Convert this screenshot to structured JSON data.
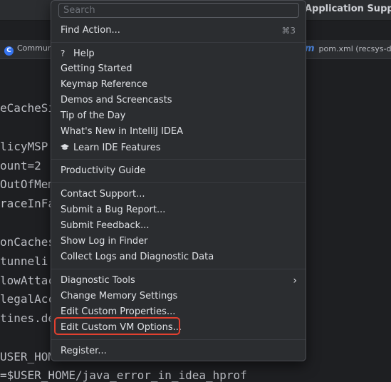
{
  "window": {
    "title_fragment": "Application Support"
  },
  "tabs": {
    "left": {
      "icon": "class-c-icon",
      "label": "Commun"
    },
    "right": {
      "icon": "maven-m-icon",
      "label": "pom.xml (recsys-d"
    }
  },
  "editor_lines": [
    "eCacheSi",
    "licyMSP",
    "ount=2",
    "OutOfMem",
    "raceInFa",
    "onCaches",
    "tunneli",
    "lowAttac",
    "legalAcc",
    "tines.de",
    "USER_HOM",
    "=$USER_HOME/java_error_in_idea_hprof"
  ],
  "menu": {
    "search_placeholder": "Search",
    "items": [
      {
        "label": "Find Action...",
        "shortcut": "⌘3"
      },
      {
        "label": "Help",
        "icon": "question-icon"
      },
      {
        "label": "Getting Started"
      },
      {
        "label": "Keymap Reference"
      },
      {
        "label": "Demos and Screencasts"
      },
      {
        "label": "Tip of the Day"
      },
      {
        "label": "What's New in IntelliJ IDEA"
      },
      {
        "label": "Learn IDE Features",
        "icon": "graduation-cap-icon"
      },
      {
        "label": "Productivity Guide"
      },
      {
        "label": "Contact Support..."
      },
      {
        "label": "Submit a Bug Report..."
      },
      {
        "label": "Submit Feedback..."
      },
      {
        "label": "Show Log in Finder"
      },
      {
        "label": "Collect Logs and Diagnostic Data"
      },
      {
        "label": "Diagnostic Tools",
        "submenu": true
      },
      {
        "label": "Change Memory Settings"
      },
      {
        "label": "Edit Custom Properties..."
      },
      {
        "label": "Edit Custom VM Options...",
        "highlighted": true
      },
      {
        "label": "Register..."
      }
    ]
  },
  "colors": {
    "background": "#1e1f22",
    "popup": "#2b2d30",
    "highlight_border": "#e2402f"
  }
}
